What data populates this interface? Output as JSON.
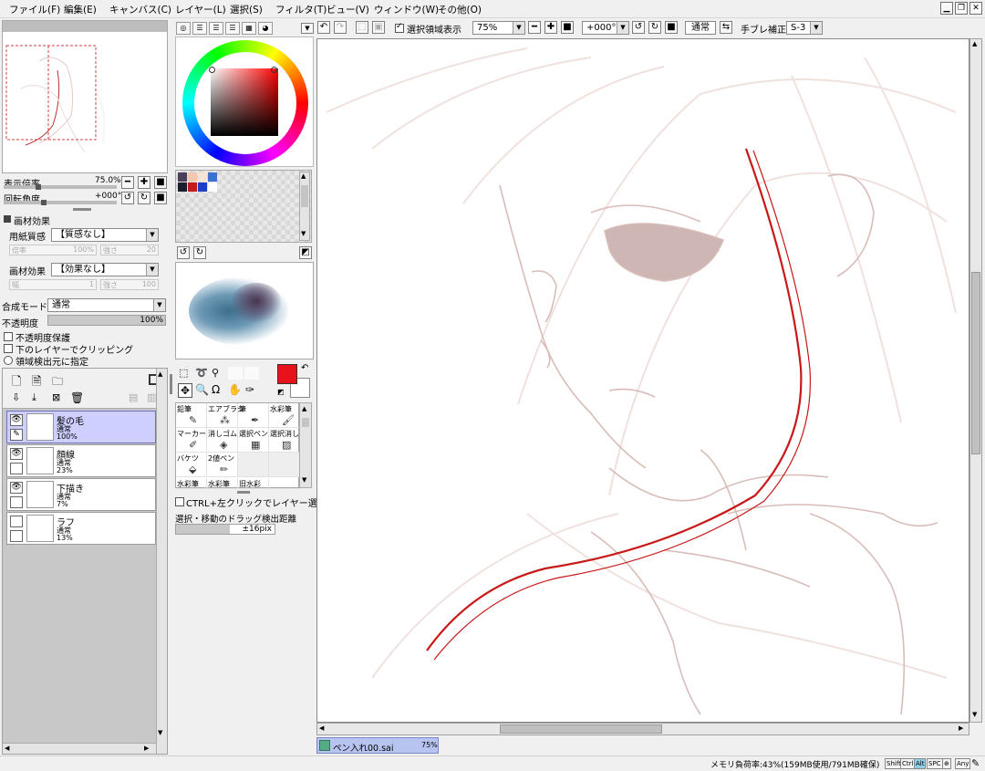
{
  "menu": [
    "ファイル(F)",
    "編集(E)",
    "キャンバス(C)",
    "レイヤー(L)",
    "選択(S)",
    "フィルタ(T)",
    "ビュー(V)",
    "ウィンドウ(W)",
    "その他(O)"
  ],
  "window_buttons": [
    "minimize",
    "restore",
    "close"
  ],
  "toolbar": {
    "show_selection_label": "選択領域表示",
    "zoom_value": "75%",
    "rotation_value": "+000°",
    "blend_label": "通常",
    "stabilizer_label": "手ブレ補正",
    "stabilizer_value": "S-3"
  },
  "view": {
    "zoom_label": "表示倍率",
    "zoom_value": "75.0%",
    "zoom_fraction": 0.3,
    "rotation_label": "回転角度",
    "rotation_value": "+000°",
    "rotation_fraction": 0.35
  },
  "texture": {
    "section_title": "画材効果",
    "paper_label": "用紙質感",
    "paper_value": "【質感なし】",
    "paper_scale_label": "倍率",
    "paper_scale_value": "100%",
    "paper_strength_label": "強さ",
    "paper_strength_value": "20",
    "effect_label": "画材効果",
    "effect_value": "【効果なし】",
    "effect_width_label": "幅",
    "effect_width_value": "1",
    "effect_strength_label": "強さ",
    "effect_strength_value": "100"
  },
  "layer_props": {
    "blend_mode_label": "合成モード",
    "blend_mode_value": "通常",
    "opacity_label": "不透明度",
    "opacity_value": "100%",
    "opacity_fraction": 1.0,
    "preserve_opacity": "不透明度保護",
    "clipping": "下のレイヤーでクリッピング",
    "selection_source": "領域検出元に指定"
  },
  "layers": [
    {
      "name": "髪の毛",
      "mode": "通常",
      "opacity": "100%",
      "selected": true
    },
    {
      "name": "顔線",
      "mode": "通常",
      "opacity": "23%",
      "selected": false
    },
    {
      "name": "下描き",
      "mode": "通常",
      "opacity": "7%",
      "selected": false
    },
    {
      "name": "ラフ",
      "mode": "通常",
      "opacity": "13%",
      "selected": false
    }
  ],
  "colors": {
    "primary": "#e8121a",
    "secondary": "#ffffff",
    "swatches": [
      "#4a3e5a",
      "#f2c9b0",
      "#f7e3d3",
      "#3a72d0",
      "#1a1f2e",
      "#c41a1a",
      "#1a3fc8",
      "#ffffff"
    ]
  },
  "brushes": [
    [
      "鉛筆",
      "エアブラシ",
      "筆",
      "水彩筆"
    ],
    [
      "マーカー",
      "消しゴム",
      "選択ペン",
      "選択消し"
    ],
    [
      "バケツ",
      "2値ペン",
      "",
      ""
    ],
    [
      "水彩筆",
      "水彩筆",
      "旧水彩",
      ""
    ]
  ],
  "tool_options": {
    "ctrl_select": "CTRL+左クリックでレイヤー選択",
    "drag_distance_label": "選択・移動のドラッグ検出距離",
    "drag_distance_value": "±16pix",
    "drag_distance_fraction": 0.55
  },
  "file_tab": {
    "name": "ペン入れ00.sai",
    "zoom": "75%"
  },
  "status": {
    "memory": "メモリ負荷率:43%(159MB使用/791MB確保)",
    "mods": [
      "Shift",
      "Ctrl",
      "Alt",
      "SPC",
      "⊕",
      "Any"
    ]
  }
}
